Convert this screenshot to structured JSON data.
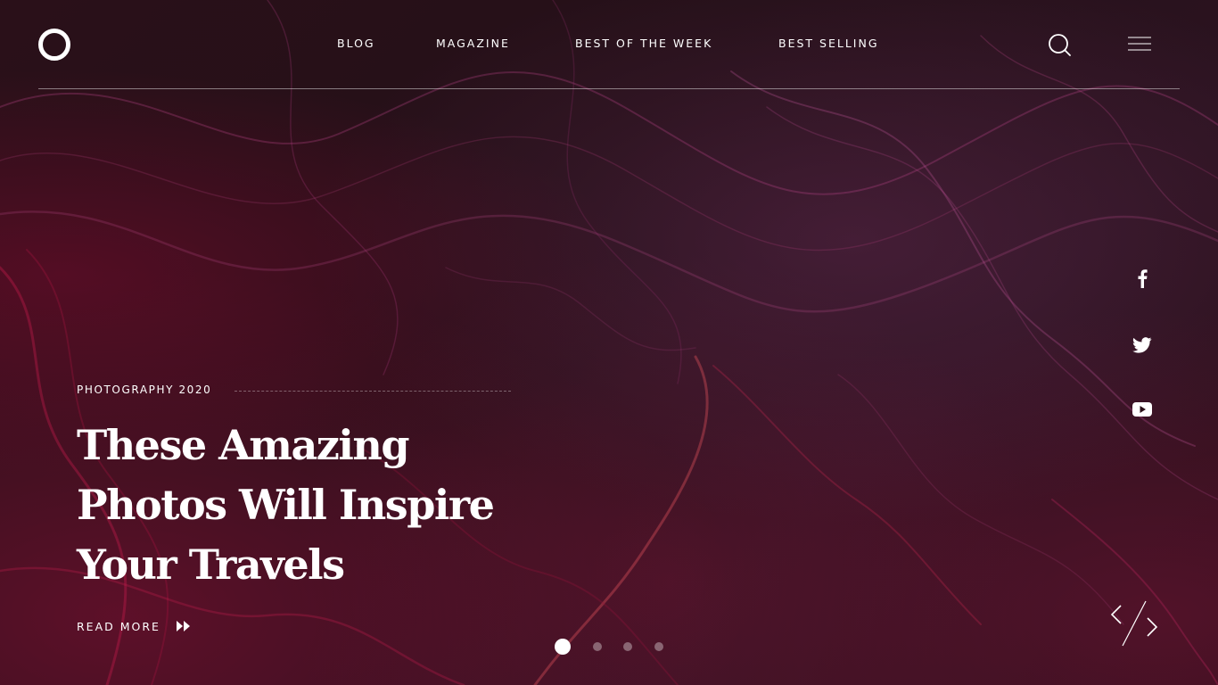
{
  "brand": {
    "logo_icon": "ring-logo-icon"
  },
  "nav": {
    "items": [
      {
        "label": "BLOG"
      },
      {
        "label": "MAGAZINE"
      },
      {
        "label": "BEST OF THE WEEK"
      },
      {
        "label": "BEST SELLING"
      }
    ],
    "search_icon": "search-icon",
    "menu_icon": "hamburger-menu-icon"
  },
  "social": [
    {
      "icon": "facebook-icon"
    },
    {
      "icon": "twitter-icon"
    },
    {
      "icon": "youtube-icon"
    }
  ],
  "hero": {
    "kicker": "PHOTOGRAPHY 2020",
    "headline_lines": [
      "These Amazing",
      "Photos Will Inspire",
      "Your Travels"
    ],
    "read_more": "READ MORE",
    "read_more_icon": "double-play-arrow-icon"
  },
  "slider": {
    "total_slides": 4,
    "active_slide": 1,
    "prev_icon": "chevron-left-icon",
    "next_icon": "chevron-right-icon"
  },
  "colors": {
    "text": "#ffffff",
    "background": "#241018",
    "accent_crimson": "#8c0f37",
    "accent_plum": "#6e3264"
  }
}
